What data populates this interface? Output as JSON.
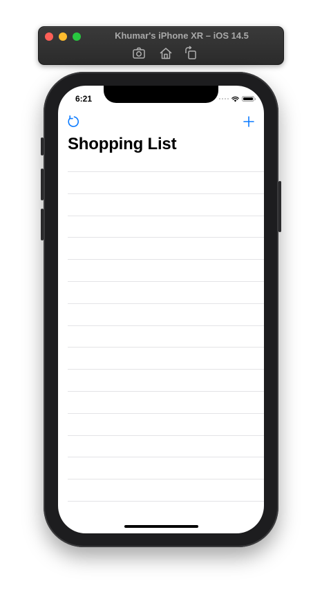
{
  "simulator": {
    "title": "Khumar's iPhone XR – iOS 14.5",
    "icons": [
      "screenshot-icon",
      "home-icon",
      "rotate-icon"
    ]
  },
  "status_bar": {
    "time": "6:21",
    "icons": [
      "signal-icon",
      "wifi-icon",
      "battery-icon"
    ]
  },
  "nav": {
    "left_icon": "refresh-icon",
    "right_icon": "plus-icon",
    "title": "Shopping List"
  },
  "list": {
    "empty_rows": 16
  },
  "colors": {
    "accent": "#0a7aff",
    "separator": "#e3e3e6",
    "sim_bar": "#2b2b2b",
    "close": "#fe5f57",
    "minimize": "#febc2e",
    "zoom": "#28c840"
  }
}
